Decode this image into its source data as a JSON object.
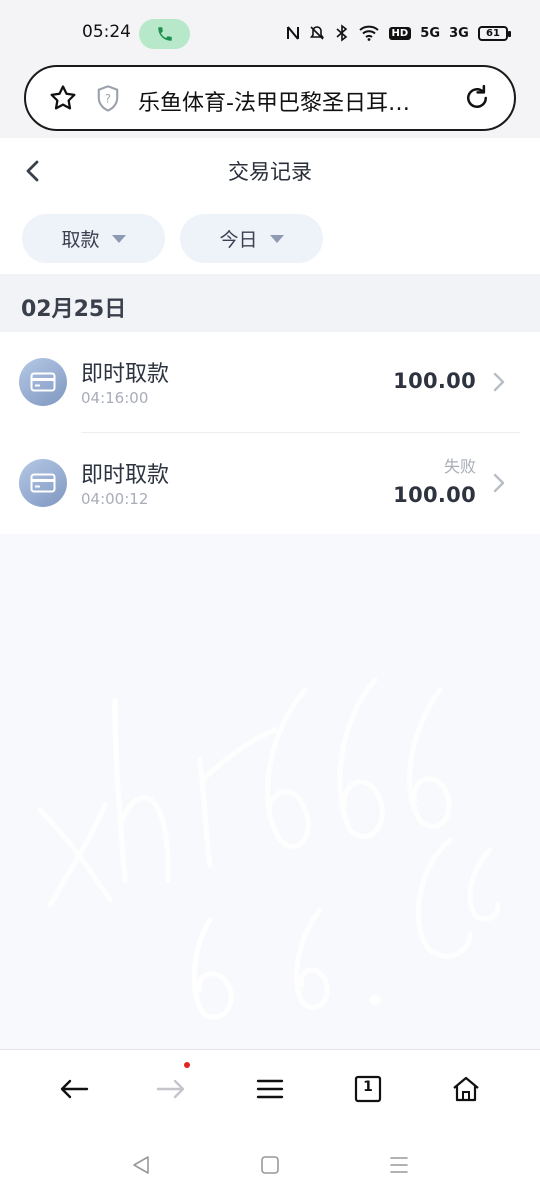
{
  "status_bar": {
    "time": "05:24",
    "network_5g": "5G",
    "network_3g": "3G",
    "hd_label": "HD",
    "battery": "61"
  },
  "browser": {
    "url_title": "乐鱼体育-法甲巴黎圣日耳…"
  },
  "page": {
    "title": "交易记录"
  },
  "filters": [
    {
      "label": "取款"
    },
    {
      "label": "今日"
    }
  ],
  "section": {
    "date": "02月25日"
  },
  "transactions": [
    {
      "title": "即时取款",
      "time": "04:16:00",
      "status": "",
      "amount": "100.00"
    },
    {
      "title": "即时取款",
      "time": "04:00:12",
      "status": "失败",
      "amount": "100.00"
    }
  ],
  "toolbar": {
    "tabs_count": "1"
  },
  "colors": {
    "accent_icon_top": "#b5c8e6",
    "accent_icon_bottom": "#7f97c0",
    "call_pill": "#b6e8c9",
    "notif_dot": "#e52222"
  },
  "icons": {
    "status": [
      "call-icon",
      "nfc-icon",
      "mute-icon",
      "bluetooth-icon",
      "wifi-icon"
    ],
    "browser": [
      "star-icon",
      "shield-icon",
      "reload-icon"
    ],
    "toolbar": [
      "back-arrow-icon",
      "forward-arrow-icon",
      "menu-icon",
      "tabs-icon",
      "home-icon"
    ],
    "system": [
      "nav-back-icon",
      "nav-home-icon",
      "nav-recents-icon"
    ]
  }
}
